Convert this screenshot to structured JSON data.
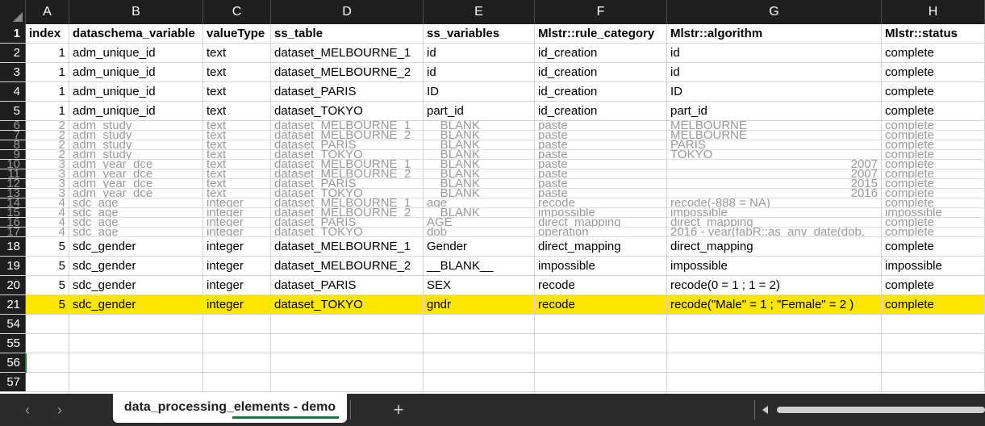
{
  "columns": [
    "A",
    "B",
    "C",
    "D",
    "E",
    "F",
    "G",
    "H"
  ],
  "header": {
    "row_number": "1",
    "cells": [
      "index",
      "dataschema_variable",
      "valueType",
      "ss_table",
      "ss_variables",
      "Mlstr::rule_category",
      "Mlstr::algorithm",
      "Mlstr::status"
    ]
  },
  "rows": [
    {
      "row_number": "2",
      "cells": [
        "1",
        "adm_unique_id",
        "text",
        "dataset_MELBOURNE_1",
        "id",
        "id_creation",
        "id",
        "complete"
      ],
      "squashed": false,
      "highlight": false
    },
    {
      "row_number": "3",
      "cells": [
        "1",
        "adm_unique_id",
        "text",
        "dataset_MELBOURNE_2",
        "id",
        "id_creation",
        "id",
        "complete"
      ],
      "squashed": false,
      "highlight": false
    },
    {
      "row_number": "4",
      "cells": [
        "1",
        "adm_unique_id",
        "text",
        "dataset_PARIS",
        "ID",
        "id_creation",
        "ID",
        "complete"
      ],
      "squashed": false,
      "highlight": false
    },
    {
      "row_number": "5",
      "cells": [
        "1",
        "adm_unique_id",
        "text",
        "dataset_TOKYO",
        "part_id",
        "id_creation",
        "part_id",
        "complete"
      ],
      "squashed": false,
      "highlight": false
    },
    {
      "row_number": "6",
      "cells": [
        "2",
        "adm_study",
        "text",
        "dataset_MELBOURNE_1",
        "__BLANK__",
        "paste",
        "MELBOURNE",
        "complete"
      ],
      "squashed": true,
      "highlight": false
    },
    {
      "row_number": "7",
      "cells": [
        "2",
        "adm_study",
        "text",
        "dataset_MELBOURNE_2",
        "__BLANK__",
        "paste",
        "MELBOURNE",
        "complete"
      ],
      "squashed": true,
      "highlight": false
    },
    {
      "row_number": "8",
      "cells": [
        "2",
        "adm_study",
        "text",
        "dataset_PARIS",
        "__BLANK__",
        "paste",
        "PARIS",
        "complete"
      ],
      "squashed": true,
      "highlight": false
    },
    {
      "row_number": "9",
      "cells": [
        "2",
        "adm_study",
        "text",
        "dataset_TOKYO",
        "__BLANK__",
        "paste",
        "TOKYO",
        "complete"
      ],
      "squashed": true,
      "highlight": false
    },
    {
      "row_number": "10",
      "cells": [
        "3",
        "adm_year_dce",
        "text",
        "dataset_MELBOURNE_1",
        "__BLANK__",
        "paste",
        "2007",
        "complete"
      ],
      "squashed": true,
      "highlight": false
    },
    {
      "row_number": "11",
      "cells": [
        "3",
        "adm_year_dce",
        "text",
        "dataset_MELBOURNE_2",
        "__BLANK__",
        "paste",
        "2007",
        "complete"
      ],
      "squashed": true,
      "highlight": false
    },
    {
      "row_number": "12",
      "cells": [
        "3",
        "adm_year_dce",
        "text",
        "dataset_PARIS",
        "__BLANK__",
        "paste",
        "2015",
        "complete"
      ],
      "squashed": true,
      "highlight": false
    },
    {
      "row_number": "13",
      "cells": [
        "3",
        "adm_year_dce",
        "text",
        "dataset_TOKYO",
        "__BLANK__",
        "paste",
        "2016",
        "complete"
      ],
      "squashed": true,
      "highlight": false
    },
    {
      "row_number": "14",
      "cells": [
        "4",
        "sdc_age",
        "integer",
        "dataset_MELBOURNE_1",
        "age",
        "recode",
        "recode(-888 = NA)",
        "complete"
      ],
      "squashed": true,
      "highlight": false
    },
    {
      "row_number": "15",
      "cells": [
        "4",
        "sdc_age",
        "integer",
        "dataset_MELBOURNE_2",
        "__BLANK__",
        "impossible",
        "impossible",
        "impossible"
      ],
      "squashed": true,
      "highlight": false
    },
    {
      "row_number": "16",
      "cells": [
        "4",
        "sdc_age",
        "integer",
        "dataset_PARIS",
        "AGE",
        "direct_mapping",
        "direct_mapping",
        "complete"
      ],
      "squashed": true,
      "highlight": false
    },
    {
      "row_number": "17",
      "cells": [
        "4",
        "sdc_age",
        "integer",
        "dataset_TOKYO",
        "dob",
        "operation",
        "2016 - year(fabR::as_any_date(dob,",
        "complete"
      ],
      "squashed": true,
      "highlight": false
    },
    {
      "row_number": "18",
      "cells": [
        "5",
        "sdc_gender",
        "integer",
        "dataset_MELBOURNE_1",
        "Gender",
        "direct_mapping",
        "direct_mapping",
        "complete"
      ],
      "squashed": false,
      "highlight": false
    },
    {
      "row_number": "19",
      "cells": [
        "5",
        "sdc_gender",
        "integer",
        "dataset_MELBOURNE_2",
        "__BLANK__",
        "impossible",
        "impossible",
        "impossible"
      ],
      "squashed": false,
      "highlight": false
    },
    {
      "row_number": "20",
      "cells": [
        "5",
        "sdc_gender",
        "integer",
        "dataset_PARIS",
        "SEX",
        "recode",
        "recode(0 = 1 ; 1 = 2)",
        "complete"
      ],
      "squashed": false,
      "highlight": false
    },
    {
      "row_number": "21",
      "cells": [
        "5",
        "sdc_gender",
        "integer",
        "dataset_TOKYO",
        "gndr",
        "recode",
        "recode(\"Male\" = 1 ; \"Female\" = 2 )",
        "complete"
      ],
      "squashed": false,
      "highlight": true
    },
    {
      "row_number": "54",
      "cells": [
        "",
        "",
        "",
        "",
        "",
        "",
        "",
        ""
      ],
      "squashed": false,
      "highlight": false
    },
    {
      "row_number": "55",
      "cells": [
        "",
        "",
        "",
        "",
        "",
        "",
        "",
        ""
      ],
      "squashed": false,
      "highlight": false
    },
    {
      "row_number": "56",
      "cells": [
        "",
        "",
        "",
        "",
        "",
        "",
        "",
        ""
      ],
      "squashed": false,
      "highlight": false
    },
    {
      "row_number": "57",
      "cells": [
        "",
        "",
        "",
        "",
        "",
        "",
        "",
        ""
      ],
      "squashed": false,
      "highlight": false
    }
  ],
  "tabs": {
    "prev_icon": "chevron-left-icon",
    "next_icon": "chevron-right-icon",
    "active_sheet": "data_processing_elements - demo",
    "add_sheet_label": "+"
  },
  "colors": {
    "highlight": "#ffe600",
    "accent": "#217346",
    "header_bg": "#1f1f1f"
  }
}
